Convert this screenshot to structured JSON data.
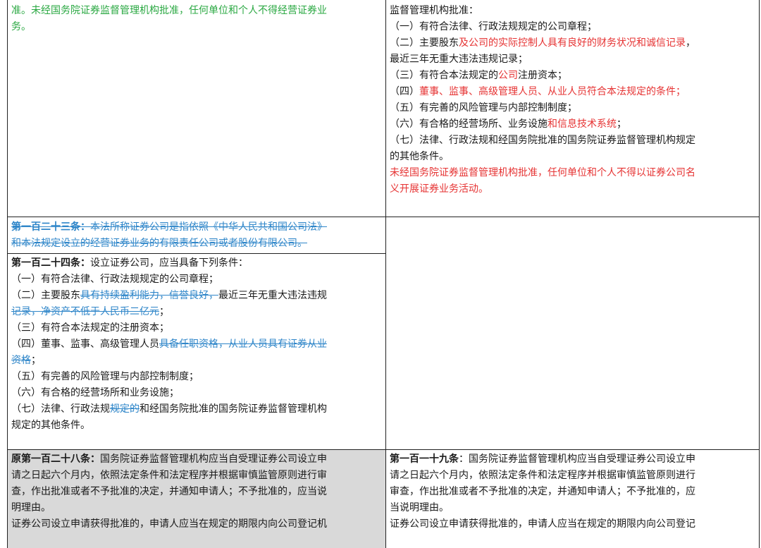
{
  "left_top": {
    "lines": [
      "准。未经国务院证券监督管理机构批准，任何单位和个人不得经营证券业",
      "务。"
    ]
  },
  "right_top": {
    "l1": "监督管理机构批准：",
    "l2": "（一）有符合法律、行政法规规定的公司章程；",
    "l3a": "（二）主要股东",
    "l3b": "及公司的实际控制人具有良好的财务状况和诚信记录",
    "l3c": "，",
    "l4": "最近三年无重大违法违规记录；",
    "l5a": "（三）有符合本法规定的",
    "l5b": "公司",
    "l5c": "注册资本；",
    "l6a": "（四）",
    "l6b": "董事、监事、高级管理人员、从业人员符合本法规定的条件；",
    "l7": "（五）有完善的风险管理与内部控制制度；",
    "l8a": "（六）有合格的经营场所、业务设施",
    "l8b": "和信息技术系统",
    "l8c": "；",
    "l9": "（七）法律、行政法规和经国务院批准的国务院证券监督管理机构规定",
    "l10": "的其他条件。",
    "l11": "未经国务院证券监督管理机构批准，任何单位和个人不得以证券公司名",
    "l12": "义开展证券业务活动。"
  },
  "art123": {
    "title": "第一百二十三条：",
    "l1": "本法所称证券公司是指依照《中华人民共和国公司法》",
    "l2": "和本法规定设立的经营证券业务的有限责任公司或者股份有限公司。"
  },
  "art124": {
    "title": "第一百二十四条：",
    "l1_text": "设立证券公司，应当具备下列条件：",
    "l2": "（一）有符合法律、行政法规规定的公司章程；",
    "l3a": "（二）主要股东",
    "l3b": "具有持续盈利能力，信誉良好，",
    "l3c": "最近三年无重大违法违规",
    "l4a": "记录，净资产不低于人民币二亿元",
    "l4b": "；",
    "l5": "（三）有符合本法规定的注册资本；",
    "l6a": "（四）董事、监事、高级管理人员",
    "l6b": "具备任职资格，从业人员具有证券从业",
    "l7a": "资格",
    "l7b": "；",
    "l8": "（五）有完善的风险管理与内部控制制度；",
    "l9": "（六）有合格的经营场所和业务设施；",
    "l10a": "（七）法律、行政法规",
    "l10b": "规定的",
    "l10c": "和经国务院批准的国务院证券监督管理机构",
    "l11": "规定的其他条件。"
  },
  "art128_old": {
    "title": "原第一百二十八条：",
    "l1_text": "国务院证券监督管理机构应当自受理证券公司设立申",
    "l2": "请之日起六个月内，依照法定条件和法定程序并根据审慎监管原则进行审",
    "l3": "查，作出批准或者不予批准的决定，并通知申请人；不予批准的，应当说",
    "l4": "明理由。",
    "l5": "证券公司设立申请获得批准的，申请人应当在规定的期限内向公司登记机"
  },
  "art119_new": {
    "title": "第一百一十九条",
    "l1_text": "：国务院证券监督管理机构应当自受理证券公司设立申",
    "l2": "请之日起六个月内，依照法定条件和法定程序并根据审慎监管原则进行",
    "l3": "审查，作出批准或者不予批准的决定，并通知申请人；不予批准的，应",
    "l4": "当说明理由。",
    "l5": "证券公司设立申请获得批准的，申请人应当在规定的期限内向公司登记"
  },
  "colors": {
    "added": "#e63333",
    "deleted": "#2f86c9",
    "green": "#2aa842",
    "old_cell_bg": "#d9d9d9"
  }
}
